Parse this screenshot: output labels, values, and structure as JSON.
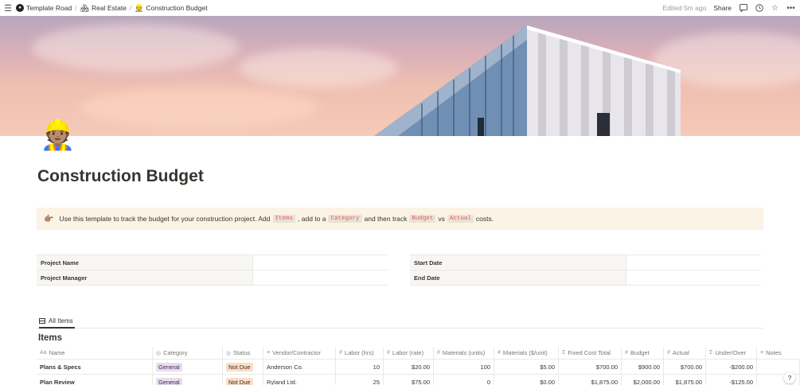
{
  "topbar": {
    "breadcrumbs": [
      {
        "label": "Template Road",
        "icon": "template-road-logo-icon"
      },
      {
        "label": "Real Estate",
        "icon": "house-emoji-icon"
      },
      {
        "label": "Construction Budget",
        "icon": "construction-worker-emoji-icon"
      }
    ],
    "separator": "/",
    "edited": "Edited 5m ago",
    "share": "Share"
  },
  "page": {
    "title": "Construction Budget",
    "icon": "construction-worker-emoji-icon"
  },
  "callout": {
    "part1": "Use this template to track the budget for your construction project. Add",
    "code1": "Items",
    "part2": ", add to a",
    "code2": "Category",
    "part3": "and then track",
    "code3": "Budget",
    "part4": "vs",
    "code4": "Actual",
    "part5": "costs."
  },
  "properties": {
    "left": [
      {
        "label": "Project Name",
        "value": ""
      },
      {
        "label": "Project Manager",
        "value": ""
      }
    ],
    "right": [
      {
        "label": "Start Date",
        "value": ""
      },
      {
        "label": "End Date",
        "value": ""
      }
    ]
  },
  "view": {
    "tab": "All Items",
    "database_title": "Items"
  },
  "table": {
    "columns": [
      {
        "label": "Name",
        "icon": "Aa"
      },
      {
        "label": "Category",
        "icon": "◎"
      },
      {
        "label": "Status",
        "icon": "◎"
      },
      {
        "label": "Vendor/Contractor",
        "icon": "≡"
      },
      {
        "label": "Labor (hrs)",
        "icon": "#"
      },
      {
        "label": "Labor (rate)",
        "icon": "#"
      },
      {
        "label": "Materials (units)",
        "icon": "#"
      },
      {
        "label": "Materials ($/unit)",
        "icon": "#"
      },
      {
        "label": "Fixed Cost Total",
        "icon": "Σ"
      },
      {
        "label": "Budget",
        "icon": "#"
      },
      {
        "label": "Actual",
        "icon": "#"
      },
      {
        "label": "Under/Over",
        "icon": "Σ"
      },
      {
        "label": "Notes",
        "icon": "≡"
      }
    ],
    "rows": [
      {
        "name": "Plans & Specs",
        "category": "General",
        "status": "Not Due",
        "vendor": "Anderson Co.",
        "labor_hrs": "10",
        "labor_rate": "$20.00",
        "mat_units": "100",
        "mat_unit_cost": "$5.00",
        "fixed_total": "$700.00",
        "budget": "$900.00",
        "actual": "$700.00",
        "under_over": "-$200.00",
        "notes": ""
      },
      {
        "name": "Plan Review",
        "category": "General",
        "status": "Not Due",
        "vendor": "Ryland Ltd.",
        "labor_hrs": "25",
        "labor_rate": "$75.00",
        "mat_units": "0",
        "mat_unit_cost": "$0.00",
        "fixed_total": "$1,875.00",
        "budget": "$2,000.00",
        "actual": "$1,875.00",
        "under_over": "-$125.00",
        "notes": ""
      }
    ]
  },
  "colors": {
    "callout_bg": "#fbf3e6",
    "code_text": "#eb5757",
    "tag_general": "#e8deee",
    "tag_not_due": "#fadec9"
  },
  "help": "?"
}
